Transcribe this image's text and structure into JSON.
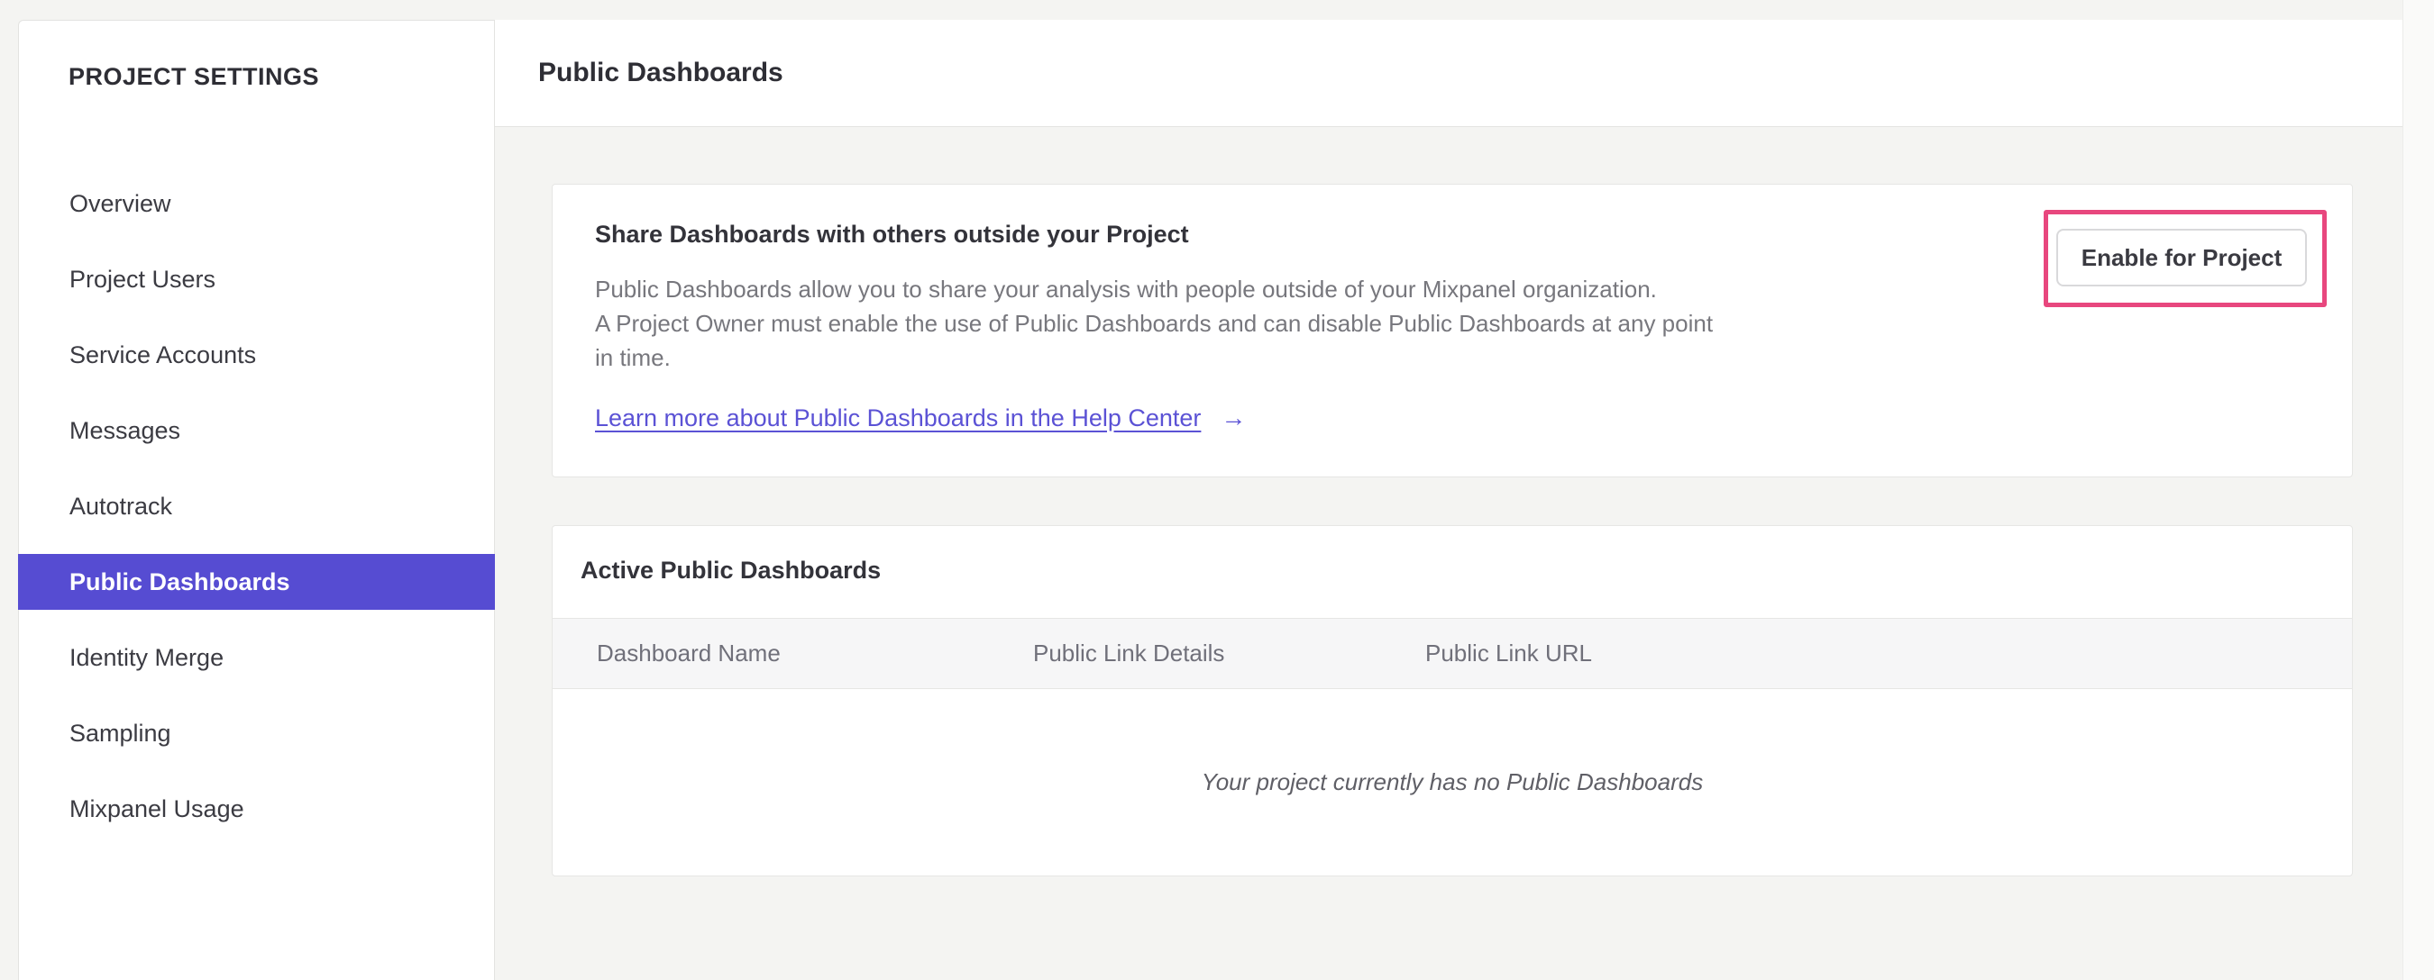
{
  "colors": {
    "accent_purple": "#564CD2",
    "link_purple": "#5B52D5",
    "highlight_pink": "#E8477E"
  },
  "sidebar": {
    "title": "PROJECT SETTINGS",
    "items": [
      {
        "label": "Overview",
        "selected": false
      },
      {
        "label": "Project Users",
        "selected": false
      },
      {
        "label": "Service Accounts",
        "selected": false
      },
      {
        "label": "Messages",
        "selected": false
      },
      {
        "label": "Autotrack",
        "selected": false
      },
      {
        "label": "Public Dashboards",
        "selected": true
      },
      {
        "label": "Identity Merge",
        "selected": false
      },
      {
        "label": "Sampling",
        "selected": false
      },
      {
        "label": "Mixpanel Usage",
        "selected": false
      }
    ]
  },
  "header": {
    "title": "Public Dashboards"
  },
  "share_card": {
    "heading": "Share Dashboards with others outside your Project",
    "description_lines": [
      "Public Dashboards allow you to share your analysis with people outside of your Mixpanel organization.",
      "A Project Owner must enable the use of Public Dashboards and can disable Public Dashboards at any point",
      "in time."
    ],
    "link_label": "Learn more about Public Dashboards in the Help Center",
    "link_arrow": "→",
    "enable_button_label": "Enable for Project"
  },
  "active_card": {
    "heading": "Active Public Dashboards",
    "columns": [
      "Dashboard Name",
      "Public Link Details",
      "Public Link URL"
    ],
    "empty_message": "Your project currently has no Public Dashboards"
  }
}
